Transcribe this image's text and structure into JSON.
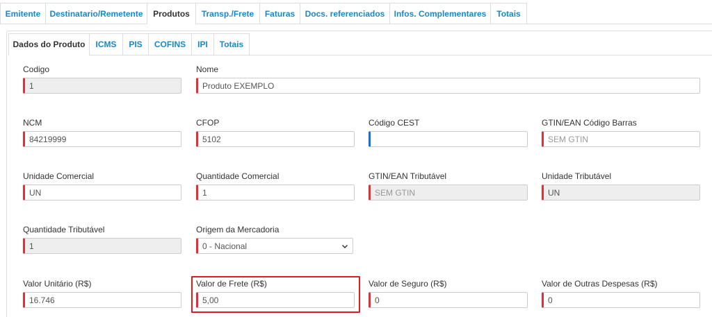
{
  "outer_tabs": [
    "Emitente",
    "Destinatario/Remetente",
    "Produtos",
    "Transp./Frete",
    "Faturas",
    "Docs. referenciados",
    "Infos. Complementares",
    "Totais"
  ],
  "outer_active": "Produtos",
  "inner_tabs": [
    "Dados do Produto",
    "ICMS",
    "PIS",
    "COFINS",
    "IPI",
    "Totais"
  ],
  "inner_active": "Dados do Produto",
  "form": {
    "codigo": {
      "label": "Codigo",
      "value": "1"
    },
    "nome": {
      "label": "Nome",
      "value": "Produto EXEMPLO"
    },
    "ncm": {
      "label": "NCM",
      "value": "84219999"
    },
    "cfop": {
      "label": "CFOP",
      "value": "5102"
    },
    "cest": {
      "label": "Código CEST",
      "value": ""
    },
    "gtin_barras": {
      "label": "GTIN/EAN Código Barras",
      "placeholder": "SEM GTIN"
    },
    "unidade_comercial": {
      "label": "Unidade Comercial",
      "value": "UN"
    },
    "quantidade_comercial": {
      "label": "Quantidade Comercial",
      "value": "1"
    },
    "gtin_tributavel": {
      "label": "GTIN/EAN Tributável",
      "placeholder": "SEM GTIN"
    },
    "unidade_tributavel": {
      "label": "Unidade Tributável",
      "value": "UN"
    },
    "quantidade_tributavel": {
      "label": "Quantidade Tributável",
      "value": "1"
    },
    "origem": {
      "label": "Origem da Mercadoria",
      "value": "0 - Nacional"
    },
    "valor_unitario": {
      "label": "Valor Unitário (R$)",
      "value": "16.746"
    },
    "valor_frete": {
      "label": "Valor de Frete (R$)",
      "value": "5,00"
    },
    "valor_seguro": {
      "label": "Valor de Seguro (R$)",
      "value": "0"
    },
    "valor_outras": {
      "label": "Valor de Outras Despesas (R$)",
      "value": "0"
    }
  },
  "colors": {
    "accent": "#1a87c9",
    "required": "#e0303a",
    "focus": "#1a6fd6",
    "highlight": "#e01b1b"
  }
}
